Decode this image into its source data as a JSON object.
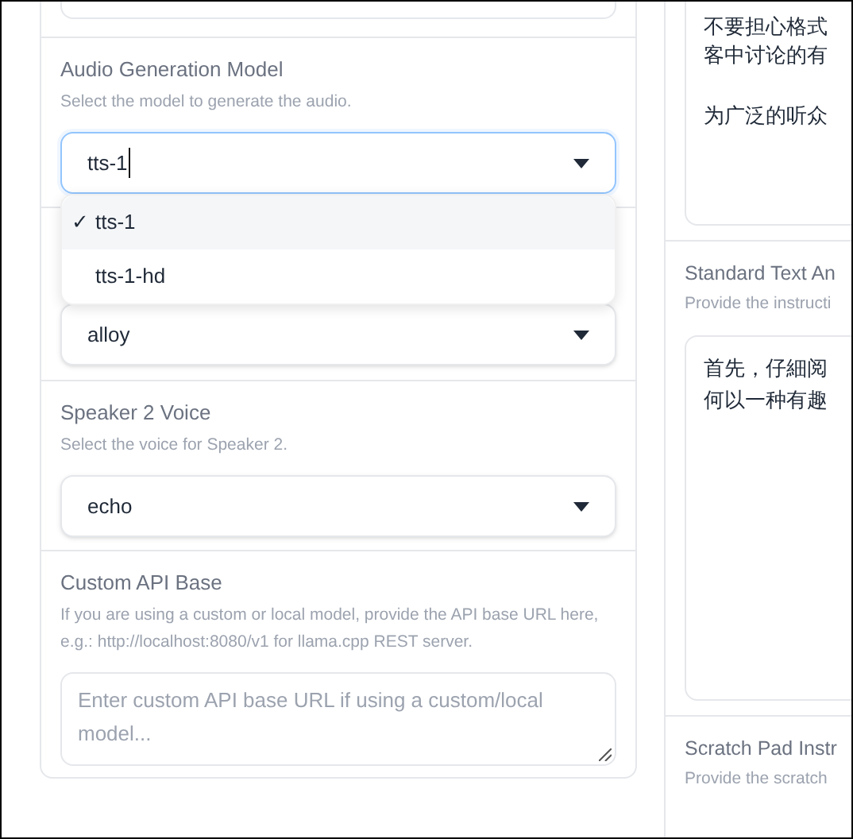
{
  "left_panel": {
    "sections": [
      {
        "kind": "select",
        "label": "Audio Generation Model",
        "hint": "Select the model to generate the audio.",
        "value": "tts-1",
        "open": true,
        "check_mark": "✓",
        "options": [
          {
            "label": "tts-1",
            "selected": true
          },
          {
            "label": "tts-1-hd",
            "selected": false
          }
        ]
      },
      {
        "kind": "select",
        "value": "alloy",
        "open": false
      },
      {
        "kind": "select",
        "label": "Speaker 2 Voice",
        "hint": "Select the voice for Speaker 2.",
        "value": "echo",
        "open": false
      },
      {
        "kind": "textarea",
        "label": "Custom API Base",
        "hint": "If you are using a custom or local model, provide the API base URL here, e.g.: http://localhost:8080/v1 for llama.cpp REST server.",
        "placeholder": "Enter custom API base URL if using a custom/local model..."
      }
    ]
  },
  "right_panel": {
    "top_paragraphs": [
      [
        "不要担心格式",
        "客中讨论的有"
      ],
      [
        "为广泛的听众"
      ]
    ],
    "sections": [
      {
        "label": "Standard Text An",
        "hint": "Provide the instructi",
        "text": [
          "首先，仔細阅",
          "何以一种有趣"
        ]
      },
      {
        "label": "Scratch Pad Instr",
        "hint": "Provide the scratch"
      }
    ]
  }
}
